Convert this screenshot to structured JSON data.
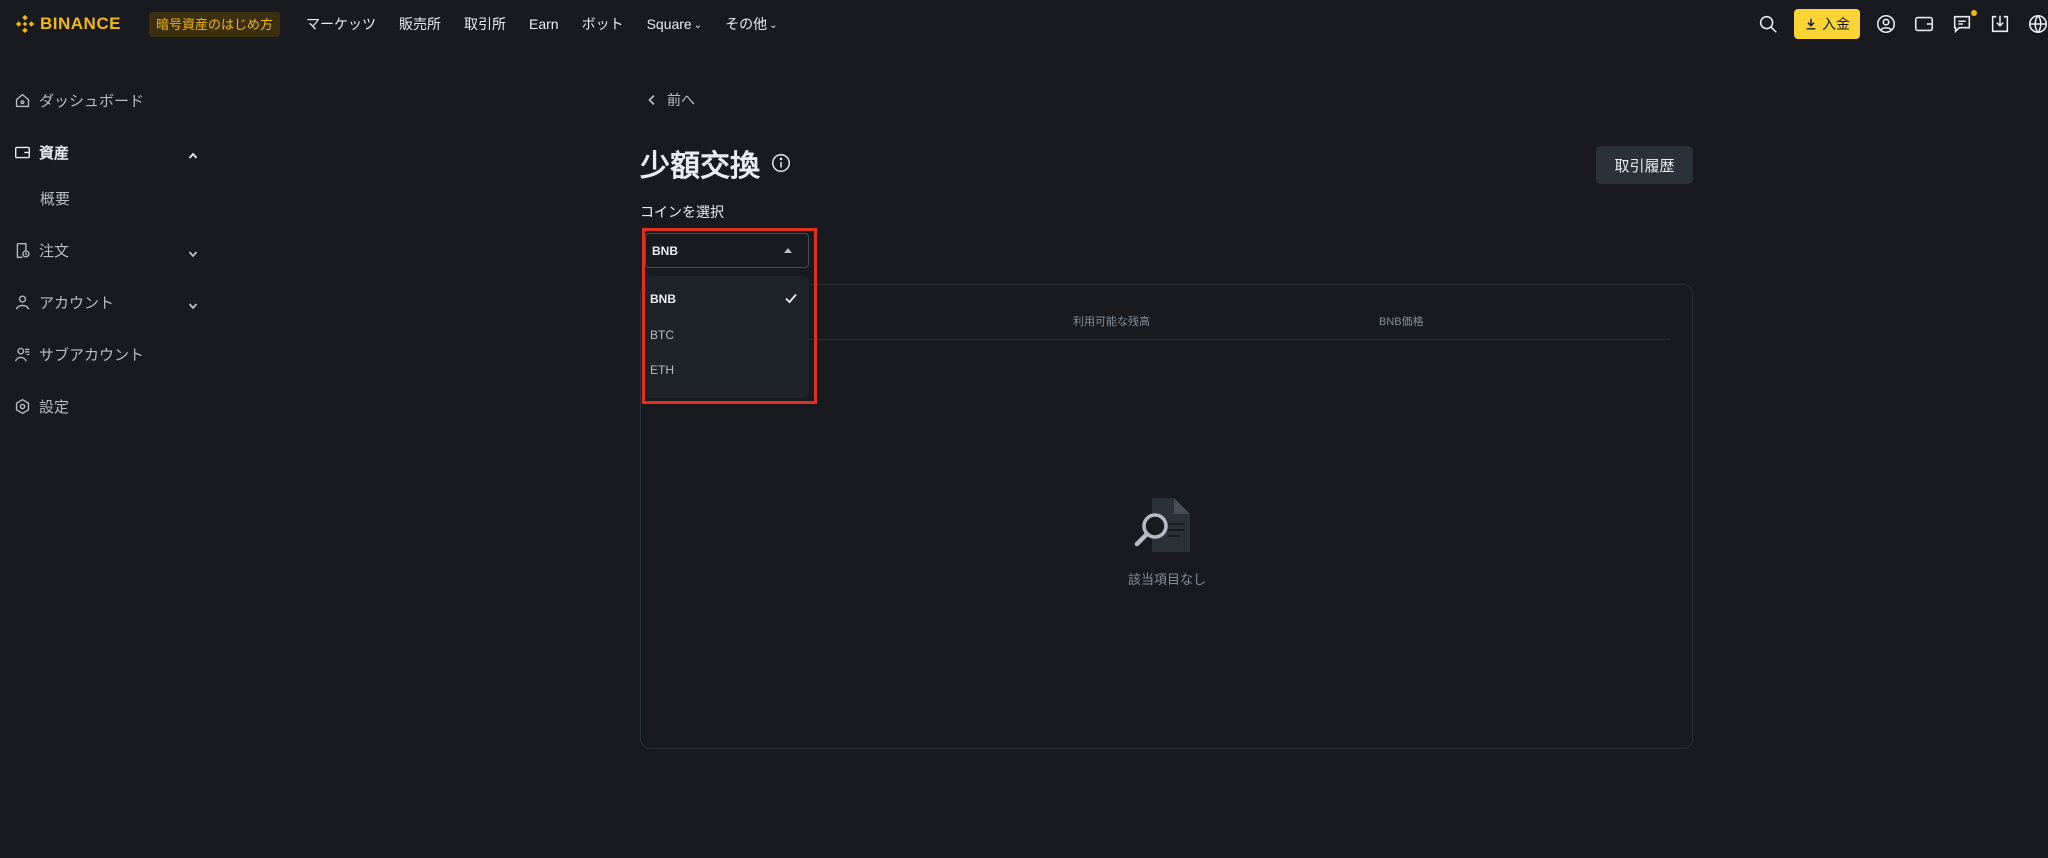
{
  "header": {
    "brand": "BINANCE",
    "guide_badge": "暗号資産のはじめ方",
    "nav": [
      {
        "label": "マーケッツ"
      },
      {
        "label": "販売所"
      },
      {
        "label": "取引所"
      },
      {
        "label": "Earn"
      },
      {
        "label": "ボット"
      },
      {
        "label": "Square"
      },
      {
        "label": "その他"
      }
    ],
    "deposit_label": "入金"
  },
  "sidebar": {
    "items": [
      {
        "label": "ダッシュボード"
      },
      {
        "label": "資産"
      },
      {
        "label": "概要"
      },
      {
        "label": "注文"
      },
      {
        "label": "アカウント"
      },
      {
        "label": "サブアカウント"
      },
      {
        "label": "設定"
      }
    ]
  },
  "main": {
    "back_label": "前へ",
    "title": "少額交換",
    "history_button": "取引履歴",
    "coin_select_label": "コインを選択",
    "selected_coin": "BNB",
    "options": [
      "BNB",
      "BTC",
      "ETH"
    ],
    "table_headers": [
      "利用可能な残高",
      "BNB価格"
    ],
    "empty_text": "該当項目なし"
  },
  "colors": {
    "background": "#181a20",
    "brand": "#f0b90b",
    "deposit": "#fcd535",
    "highlight": "#e0301e"
  }
}
